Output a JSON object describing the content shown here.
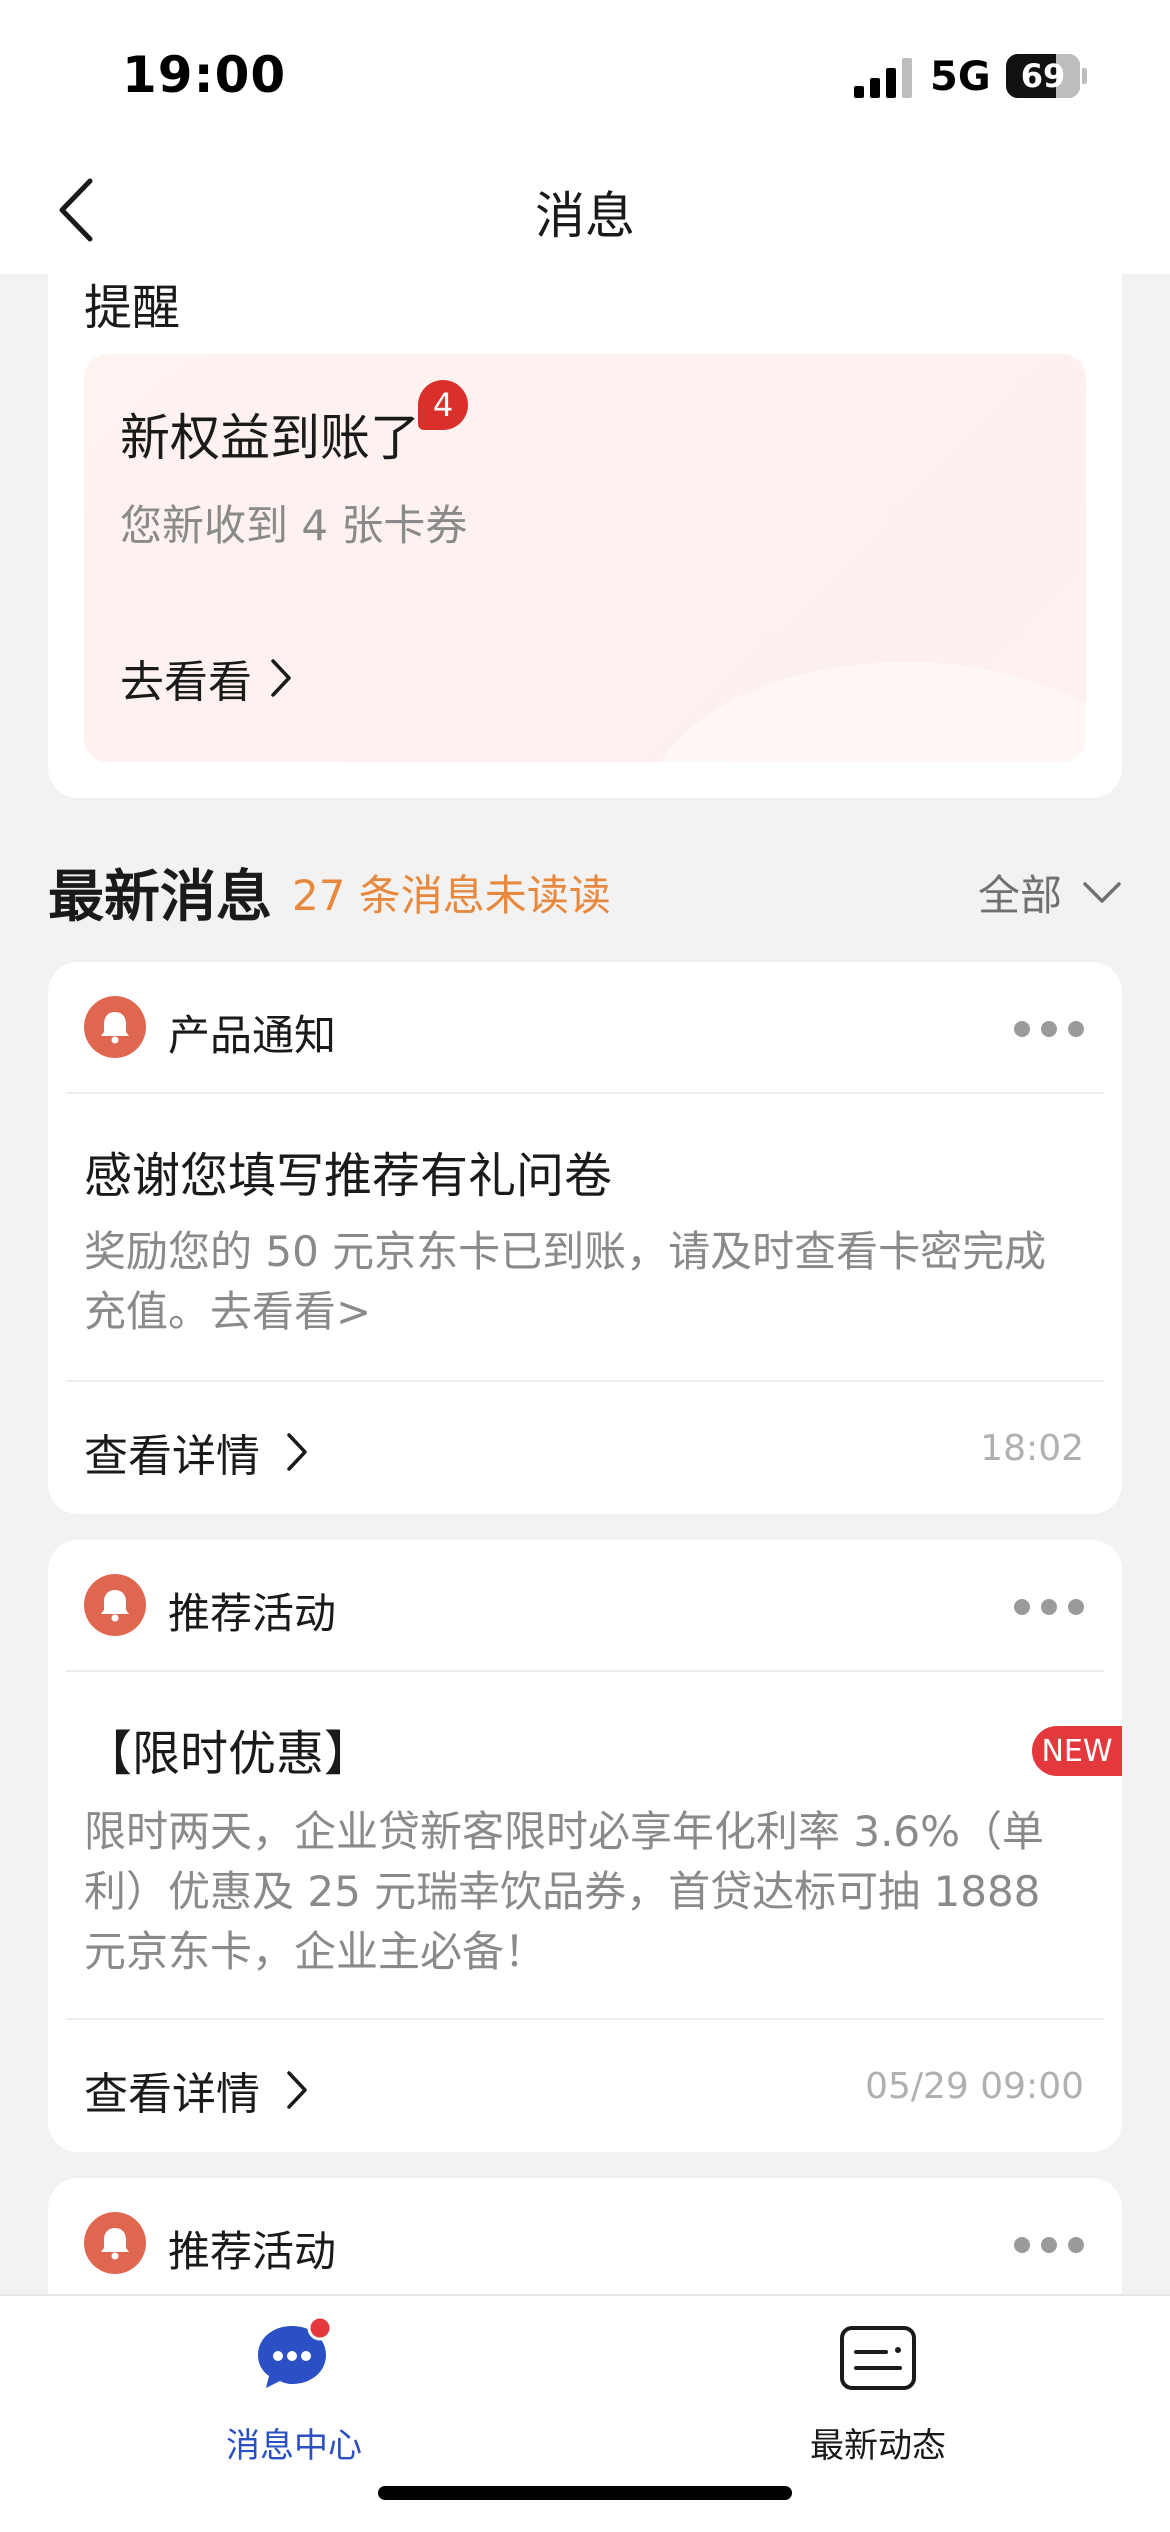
{
  "status_bar": {
    "time": "19:00",
    "network": "5G",
    "battery": "69"
  },
  "nav": {
    "title": "消息"
  },
  "reminder": {
    "heading": "提醒",
    "title": "新权益到账了",
    "badge": "4",
    "subtitle": "您新收到 4 张卡券",
    "link": "去看看"
  },
  "latest": {
    "title": "最新消息",
    "unread": "27 条消息未读读",
    "filter": "全部"
  },
  "messages": [
    {
      "category": "产品通知",
      "title": "感谢您填写推荐有礼问卷",
      "body": "奖励您的 50 元京东卡已到账，请及时查看卡密完成充值。去看看>",
      "detail": "查看详情",
      "time": "18:02"
    },
    {
      "category": "推荐活动",
      "title": "【限时优惠】",
      "badge": "NEW",
      "body": "限时两天，企业贷新客限时必享年化利率 3.6%（单利）优惠及 25 元瑞幸饮品券，首贷达标可抽 1888 元京东卡，企业主必备！",
      "detail": "查看详情",
      "time": "05/29 09:00"
    },
    {
      "category": "推荐活动"
    }
  ],
  "tabs": [
    {
      "label": "消息中心",
      "icon": "chat-bubble-icon",
      "active": true
    },
    {
      "label": "最新动态",
      "icon": "news-card-icon",
      "active": false
    }
  ],
  "colors": {
    "accent_orange": "#e8883c",
    "bell_red": "#e0674f",
    "badge_red": "#d9302c",
    "tab_active_blue": "#2b4fc4"
  }
}
